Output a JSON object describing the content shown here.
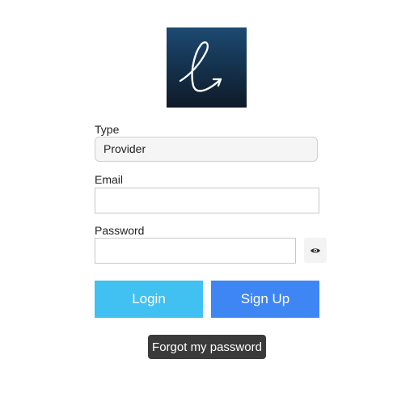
{
  "logo": {
    "icon": "cursive-e-arrow-logo",
    "colors": [
      "#1d4a72",
      "#0f1a27"
    ]
  },
  "form": {
    "type_label": "Type",
    "type_value": "Provider",
    "email_label": "Email",
    "email_value": "",
    "email_placeholder": "",
    "password_label": "Password",
    "password_value": "",
    "password_placeholder": "",
    "show_password_icon": "eye-icon"
  },
  "actions": {
    "login_label": "Login",
    "signup_label": "Sign Up",
    "forgot_label": "Forgot my password"
  },
  "colors": {
    "login": "#41c0f2",
    "signup": "#3f86f5",
    "forgot_bg": "#3a3a3a"
  }
}
